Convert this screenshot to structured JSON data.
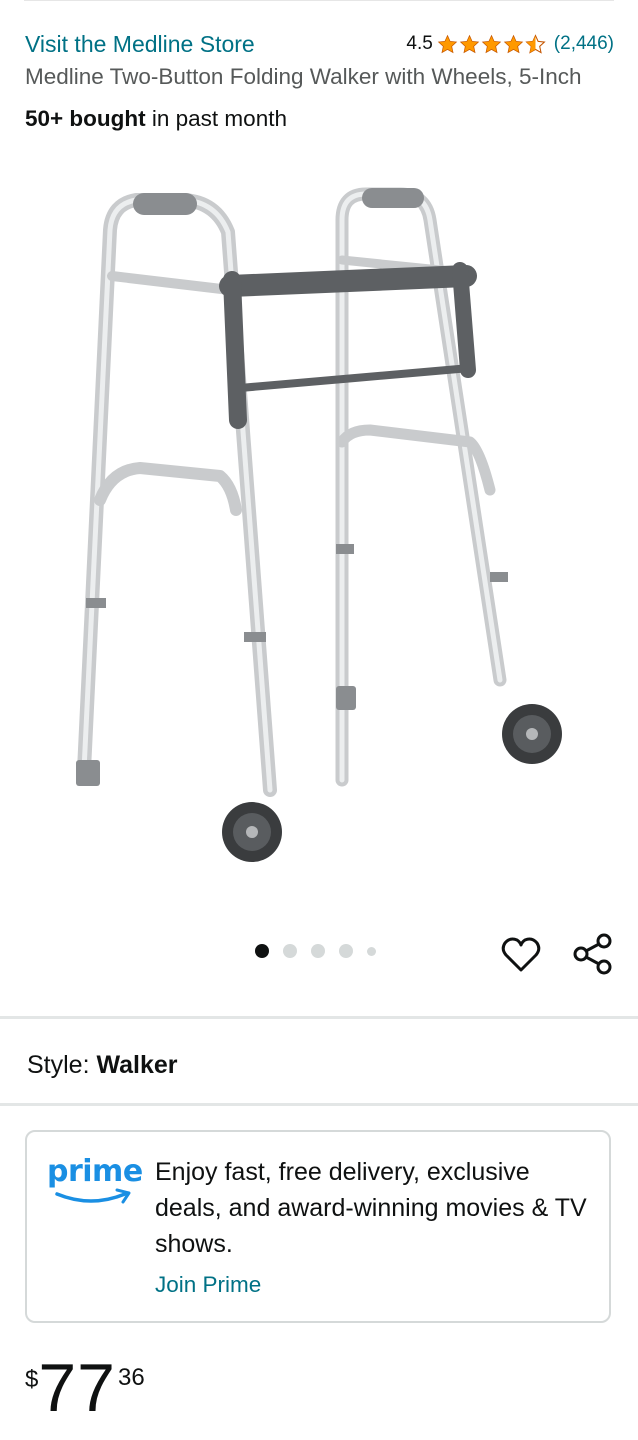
{
  "header": {
    "store_link": "Visit the Medline Store",
    "rating_value": "4.5",
    "rating_count": "(2,446)",
    "title": "Medline Two-Button Folding Walker with Wheels, 5-Inch",
    "bought_bold": "50+ bought",
    "bought_rest": " in past month"
  },
  "gallery": {
    "image_count": 5,
    "active_index": 0
  },
  "style": {
    "label": "Style:",
    "value": "Walker"
  },
  "prime": {
    "logo_text": "prime",
    "description": "Enjoy fast, free delivery, exclusive deals, and award-winning movies & TV shows.",
    "join_label": "Join Prime"
  },
  "price": {
    "currency": "$",
    "whole": "77",
    "fraction": "36"
  },
  "colors": {
    "link": "#007185",
    "star": "#ff9900",
    "prime_blue": "#1a8fe3",
    "text": "#0f1111",
    "muted": "#565959"
  },
  "icons": {
    "heart": "heart-icon",
    "share": "share-icon",
    "star": "star-icon"
  }
}
